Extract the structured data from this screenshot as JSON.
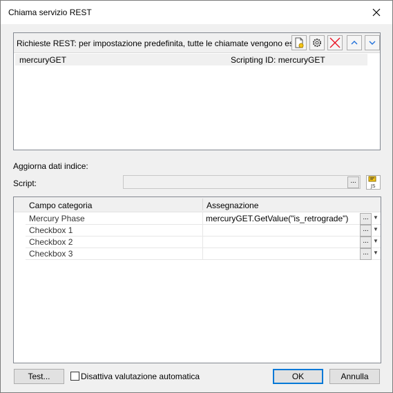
{
  "window": {
    "title": "Chiama servizio REST"
  },
  "requests": {
    "header": "Richieste REST: per impostazione predefinita, tutte le chiamate vengono eseguite c",
    "items": [
      {
        "name": "mercuryGET",
        "scripting_id": "Scripting ID: mercuryGET"
      }
    ]
  },
  "update": {
    "label": "Aggiorna dati indice:",
    "script_label": "Script:",
    "script_value": "",
    "dots": "..."
  },
  "grid": {
    "columns": [
      "Campo categoria",
      "Assegnazione"
    ],
    "rows": [
      {
        "field": "Mercury Phase",
        "assignment": "mercuryGET.GetValue(\"is_retrograde\")"
      },
      {
        "field": "Checkbox 1",
        "assignment": ""
      },
      {
        "field": "Checkbox 2",
        "assignment": ""
      },
      {
        "field": "Checkbox 3",
        "assignment": ""
      }
    ]
  },
  "footer": {
    "test_label": "Test...",
    "checkbox_label": "Disattiva valutazione automatica",
    "checkbox_checked": false,
    "ok_label": "OK",
    "cancel_label": "Annulla"
  },
  "colors": {
    "accent": "#0078d7",
    "delete": "#e81123"
  }
}
